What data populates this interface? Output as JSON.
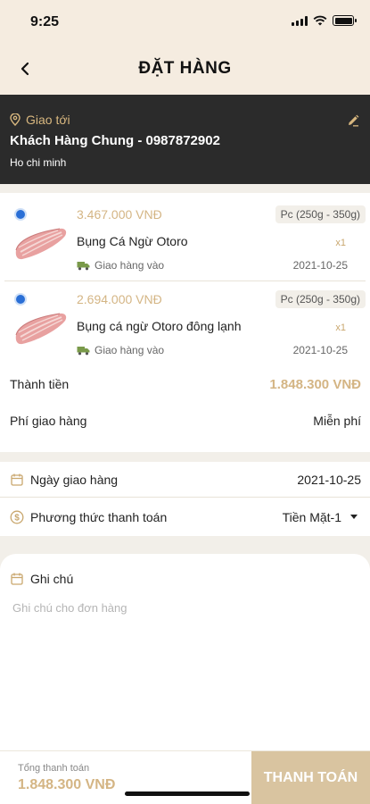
{
  "status_bar": {
    "time": "9:25"
  },
  "header": {
    "title": "ĐẶT HÀNG"
  },
  "address": {
    "label": "Giao tới",
    "name": "Khách Hàng Chung - 0987872902",
    "city": "Ho chi minh"
  },
  "products": [
    {
      "price": "3.467.000 VNĐ",
      "spec": "Pc (250g - 350g)",
      "name": "Bụng Cá Ngừ Otoro",
      "qty": "x1",
      "delivery_label": "Giao hàng vào",
      "date": "2021-10-25"
    },
    {
      "price": "2.694.000 VNĐ",
      "spec": "Pc (250g - 350g)",
      "name": "Bụng cá ngừ Otoro đông lạnh",
      "qty": "x1",
      "delivery_label": "Giao hàng vào",
      "date": "2021-10-25"
    }
  ],
  "summary": {
    "subtotal_label": "Thành tiền",
    "subtotal_value": "1.848.300 VNĐ",
    "shipping_label": "Phí giao hàng",
    "shipping_value": "Miễn phí"
  },
  "info": {
    "date_label": "Ngày giao hàng",
    "date_value": "2021-10-25",
    "payment_label": "Phương thức thanh toán",
    "payment_value": "Tiền Mặt-1"
  },
  "note": {
    "label": "Ghi chú",
    "placeholder": "Ghi chú cho đơn hàng"
  },
  "footer": {
    "total_label": "Tổng thanh toán",
    "total_value": "1.848.300 VNĐ",
    "pay_label": "THANH TOÁN"
  },
  "colors": {
    "accent_gold": "#d4b584",
    "header_bg": "#f5ece0",
    "address_bg": "#2b2b2b",
    "pay_button_bg": "#d9c4a0"
  }
}
